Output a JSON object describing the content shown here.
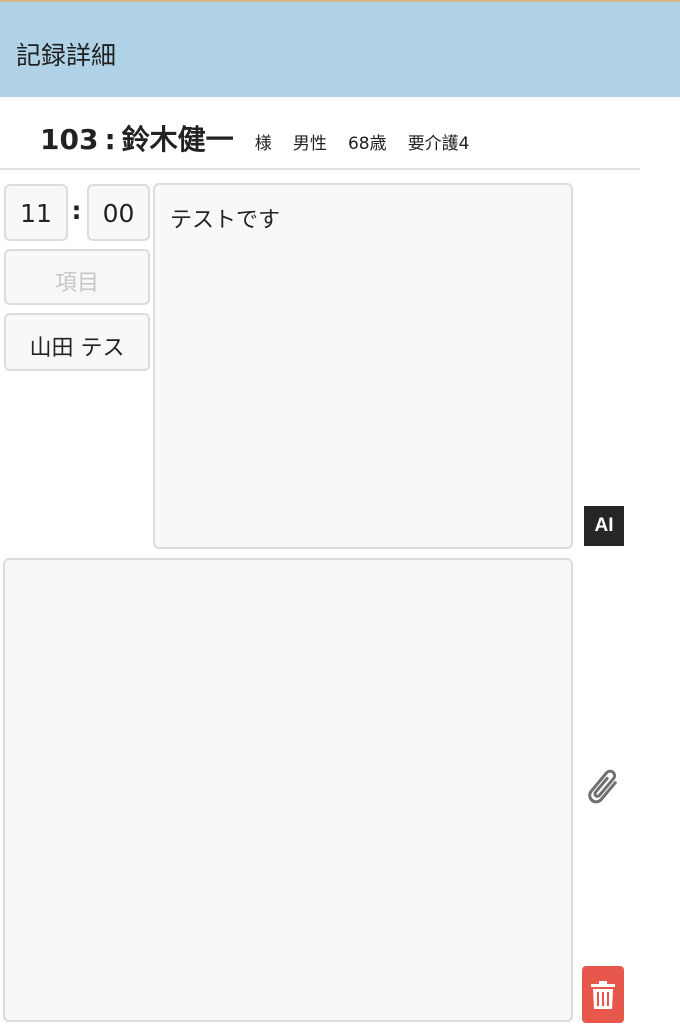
{
  "header": {
    "title": "記録詳細",
    "color": "#b0d2e6"
  },
  "patient": {
    "room": "103",
    "separator": ":",
    "name": "鈴木健一",
    "honorific": "様",
    "gender": "男性",
    "age": "68歳",
    "care_level": "要介護4"
  },
  "record": {
    "hour": "11",
    "minute": "00",
    "time_separator": ":",
    "item_placeholder": "項目",
    "staff": "山田 テス",
    "note": "テストです",
    "memo": ""
  },
  "actions": {
    "ai_label": "AI",
    "attach_icon": "paperclip-icon",
    "delete_icon": "trash-icon",
    "delete_color": "#e8574c"
  }
}
